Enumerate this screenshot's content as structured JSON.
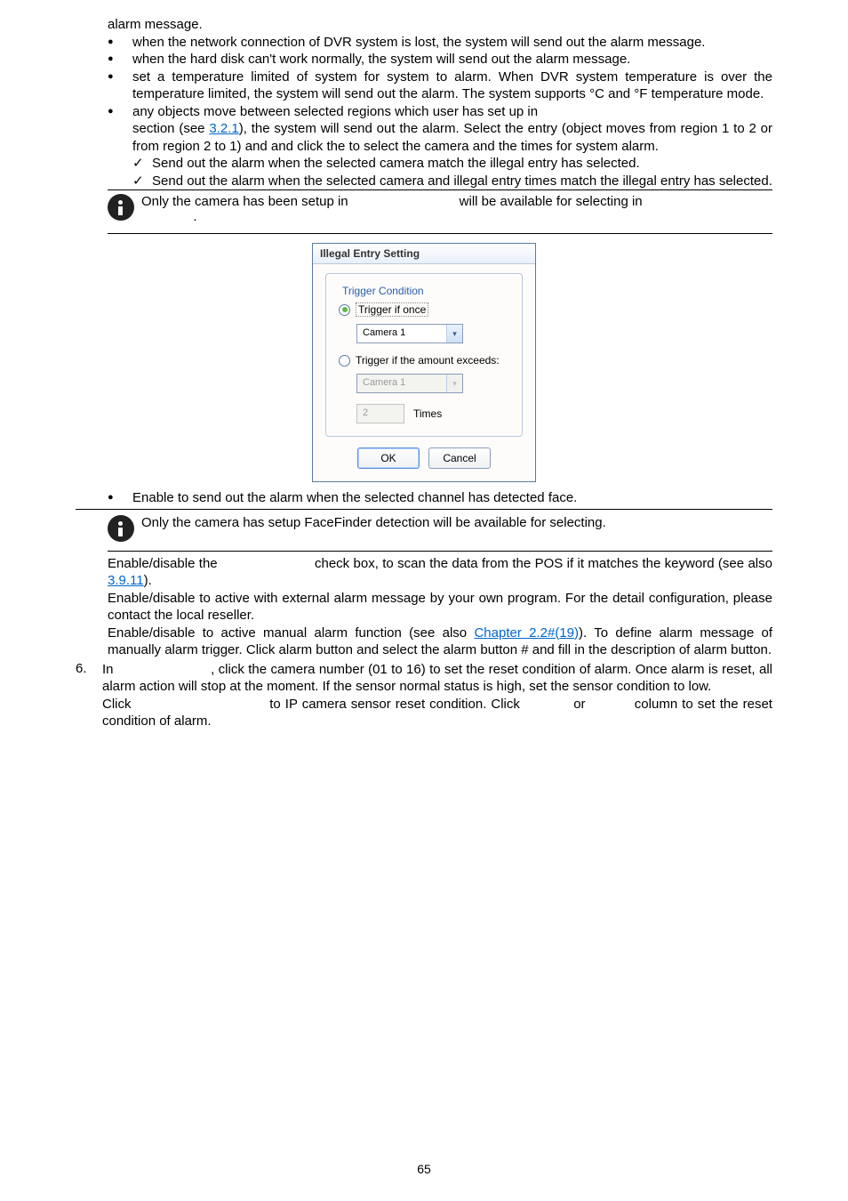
{
  "line_alarm": "alarm message.",
  "b_netdown": "when the network connection of DVR system is lost, the system will send out the alarm message.",
  "b_disk": "when the hard disk can't work normally, the system will send out the alarm message.",
  "b_temp": "set a temperature limited of system for system to alarm. When DVR system temperature is over the temperature limited, the system will send out the alarm. The system supports °C and °F temperature mode.",
  "b_illegal_1": "any objects move between selected regions which user has set up in",
  "b_illegal_2a": "section (see ",
  "b_illegal_link1": "3.2.1",
  "b_illegal_2b": "), the system will send out the alarm. Select the entry (object moves from region 1 to 2 or from region 2 to 1) and and click the",
  "b_illegal_2c": " to select the camera and the times for system alarm.",
  "check1": "Send out the alarm when the selected camera match the illegal entry has selected.",
  "check2": "Send out the alarm when the selected camera and illegal entry times match the illegal entry has selected.",
  "info1a": "Only the camera has been setup in ",
  "info1b": " will be available for selecting in",
  "info1c": ".",
  "dialog": {
    "title": "Illegal Entry Setting",
    "legend": "Trigger Condition",
    "opt1": "Trigger if once",
    "cam_sel": "Camera 1",
    "opt2": "Trigger if the amount exceeds:",
    "cam2": "Camera 1",
    "count": "2",
    "times": "Times",
    "ok": "OK",
    "cancel": "Cancel"
  },
  "b_face": "Enable to send out the alarm when the selected channel has detected face.",
  "info2": "Only the camera has setup FaceFinder detection will be available for selecting.",
  "en1a": "Enable/disable the ",
  "en1b": " check box, to scan the data from the POS if it matches the keyword (see also ",
  "en1_link": "3.9.11",
  "en1c": ").",
  "en2": "Enable/disable to active with external alarm message by your own program. For the detail configuration, please contact the local reseller.",
  "en3a": "Enable/disable to active manual alarm function (see also ",
  "en3_link": "Chapter 2.2#(19)",
  "en3b": "). To define alarm message of manually alarm trigger. Click alarm button and select the alarm button # and fill in the description of alarm button.",
  "six_num": "6.",
  "six_a": "In ",
  "six_b": ", click the camera number (01 to 16) to set the reset condition of alarm. Once alarm is reset, all alarm action will stop at the moment. If the sensor normal status is high, set the sensor condition to low.",
  "six_c1": "Click ",
  "six_c2": " to IP camera sensor reset condition. Click ",
  "six_c3": " or ",
  "six_c4": " column to set the reset condition of alarm.",
  "page_num": "65"
}
